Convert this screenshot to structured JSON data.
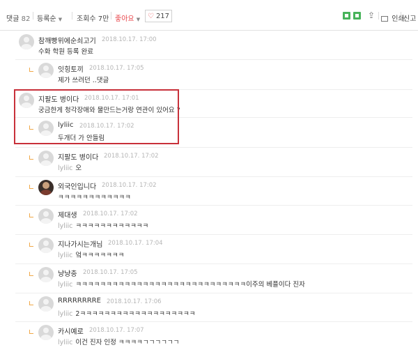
{
  "toolbar": {
    "comments_label": "댓글",
    "comments_count": "82",
    "sort_label": "등록순",
    "views_label": "조회수 7만",
    "like_label": "좋아요",
    "like_count": "217",
    "print_label": "인쇄",
    "report_label": "신고",
    "sort_arrow": "▼",
    "like_arrow": "▼",
    "heart": "♡",
    "share_glyph": "⇪",
    "brand_color": "#47b35a",
    "like_color": "#e8454a",
    "icons": [
      "bookmark-green-icon",
      "green-square-icon",
      "share-icon",
      "print-icon"
    ]
  },
  "comments": [
    {
      "name": "참깨빵위에순쇠고기",
      "date": "2018.10.17. 17:00",
      "mention": "",
      "text": "수화 학원 등록 완료",
      "reply": false,
      "avatar": "default"
    },
    {
      "name": "잇힝토끼",
      "date": "2018.10.17. 17:05",
      "mention": "",
      "text": "제가 쓰려던 ..댓글",
      "reply": true,
      "avatar": "default"
    },
    {
      "name": "지팔도 병이다",
      "date": "2018.10.17. 17:01",
      "mention": "",
      "text": "궁금한게 청각장애와 물만드는거랑 연관이 있어요 ?",
      "reply": false,
      "avatar": "default"
    },
    {
      "name": "lyliic",
      "date": "2018.10.17. 17:02",
      "mention": "",
      "text": "두개더 가 안들림",
      "reply": true,
      "avatar": "default"
    },
    {
      "name": "지팔도 병이다",
      "date": "2018.10.17. 17:02",
      "mention": "lyliic",
      "text": "오",
      "reply": true,
      "avatar": "default"
    },
    {
      "name": "외국인입니다",
      "date": "2018.10.17. 17:02",
      "mention": "",
      "text": "ㅋㅋㅋㅋㅋㅋㅋㅋㅋㅋㅋㅋ",
      "reply": true,
      "avatar": "photo"
    },
    {
      "name": "제대생",
      "date": "2018.10.17. 17:02",
      "mention": "lyliic",
      "text": "ㅋㅋㅋㅋㅋㅋㅋㅋㅋㅋㅋㅋ",
      "reply": true,
      "avatar": "default"
    },
    {
      "name": "지나가시는개님",
      "date": "2018.10.17. 17:04",
      "mention": "lyliic",
      "text": "엌ㅋㅋㅋㅋㅋㅋㅋ",
      "reply": true,
      "avatar": "default"
    },
    {
      "name": "냥냥충",
      "date": "2018.10.17. 17:05",
      "mention": "lyliic",
      "text": "ㅋㅋㅋㅋㅋㅋㅋㅋㅋㅋㅋㅋㅋㅋㅋㅋㅋㅋㅋㅋㅋㅋㅋㅋㅋㅋㅋㅋ이주의 베플이다 진자",
      "reply": true,
      "avatar": "default"
    },
    {
      "name": "RRRRRRRRE",
      "date": "2018.10.17. 17:06",
      "mention": "lyliic",
      "text": "2ㅋㅋㅋㅋㅋㅋㅋㅋㅋㅋㅋㅋㅋㅋㅋㅋㅋㅋㅋ",
      "reply": true,
      "avatar": "default"
    },
    {
      "name": "카시예로",
      "date": "2018.10.17. 17:07",
      "mention": "lyliic",
      "text": "이건 진자 인정 ㅋㅋㅋㅋㄱㄱㄱㄱㄱㄱ",
      "reply": true,
      "avatar": "default"
    }
  ]
}
